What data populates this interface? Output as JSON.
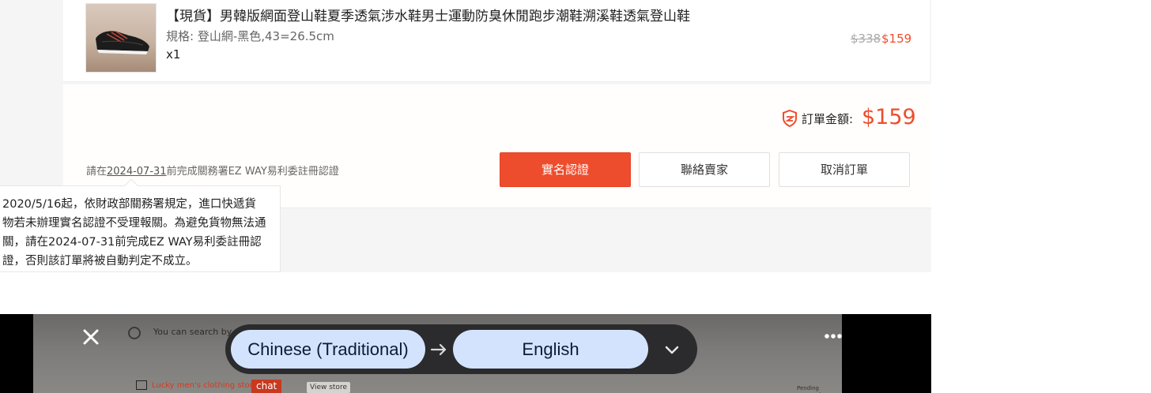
{
  "order": {
    "product_title": "【現貨】男韓版網面登山鞋夏季透氣涉水鞋男士運動防臭休閒跑步潮鞋溯溪鞋透氣登山鞋",
    "variant": "規格: 登山網-黑色,43=26.5cm",
    "quantity": "x1",
    "original_price": "$338",
    "sale_price": "$159"
  },
  "summary": {
    "total_label": "訂單金額:",
    "total_value": "$159",
    "notice_prefix": "請在",
    "notice_date": "2024-07-31",
    "notice_suffix": "前完成關務署EZ WAY易利委註冊認證",
    "buttons": {
      "verify": "實名認證",
      "contact_seller": "聯絡賣家",
      "cancel_order": "取消訂單"
    }
  },
  "tooltip": {
    "text": "2020/5/16起，依財政部關務署規定，進口快遞貨物若未辦理實名認證不受理報關。為避免貨物無法通關，請在2024-07-31前完成EZ WAY易利委註冊認證，否則該訂單將被自動判定不成立。"
  },
  "camera_feed": {
    "search_text": "You can search by s",
    "store_name": "Lucky men's clothing storexy",
    "chat_label": "chat",
    "view_store_label": "View store",
    "pending_label": "Pending payment"
  },
  "translate_bar": {
    "source_language": "Chinese (Traditional)",
    "target_language": "English"
  },
  "icons": {
    "close": "close-icon",
    "more": "more-vertical-icon",
    "swap": "arrow-right-icon",
    "dropdown": "chevron-down-icon",
    "shield": "shield-icon"
  },
  "colors": {
    "accent": "#ee4d2d",
    "pill": "#d3e3fd",
    "bar": "#2b2b2d"
  }
}
